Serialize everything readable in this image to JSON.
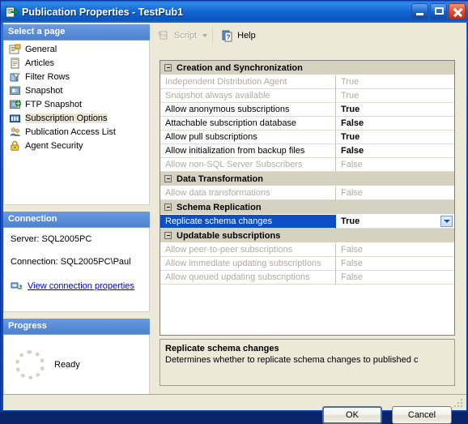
{
  "window": {
    "title": "Publication Properties - TestPub1",
    "icon": "publication-icon",
    "buttons": {
      "minimize": "Minimize",
      "maximize": "Maximize",
      "close": "Close"
    }
  },
  "sidebar": {
    "select_page_header": "Select a page",
    "items": [
      {
        "label": "General",
        "icon": "general-page-icon",
        "selected": false
      },
      {
        "label": "Articles",
        "icon": "articles-page-icon",
        "selected": false
      },
      {
        "label": "Filter Rows",
        "icon": "filter-rows-page-icon",
        "selected": false
      },
      {
        "label": "Snapshot",
        "icon": "snapshot-page-icon",
        "selected": false
      },
      {
        "label": "FTP Snapshot",
        "icon": "ftp-snapshot-page-icon",
        "selected": false
      },
      {
        "label": "Subscription Options",
        "icon": "subscription-options-page-icon",
        "selected": true
      },
      {
        "label": "Publication Access List",
        "icon": "publication-access-list-page-icon",
        "selected": false
      },
      {
        "label": "Agent Security",
        "icon": "agent-security-page-icon",
        "selected": false
      }
    ],
    "connection": {
      "header": "Connection",
      "server": "Server: SQL2005PC",
      "connection": "Connection: SQL2005PC\\Paul",
      "link": "View connection properties",
      "link_icon": "connection-properties-icon"
    },
    "progress": {
      "header": "Progress",
      "status": "Ready",
      "icon": "progress-spinner-icon"
    }
  },
  "toolbar": {
    "script_label": "Script",
    "script_icon": "script-icon",
    "script_enabled": false,
    "help_label": "Help",
    "help_icon": "help-icon"
  },
  "grid": {
    "sections": [
      {
        "title": "Creation and Synchronization",
        "rows": [
          {
            "name": "Independent Distribution Agent",
            "value": "True",
            "enabled": false,
            "selected": false
          },
          {
            "name": "Snapshot always available",
            "value": "True",
            "enabled": false,
            "selected": false
          },
          {
            "name": "Allow anonymous subscriptions",
            "value": "True",
            "enabled": true,
            "selected": false
          },
          {
            "name": "Attachable subscription database",
            "value": "False",
            "enabled": true,
            "selected": false
          },
          {
            "name": "Allow pull subscriptions",
            "value": "True",
            "enabled": true,
            "selected": false
          },
          {
            "name": "Allow initialization from backup files",
            "value": "False",
            "enabled": true,
            "selected": false
          },
          {
            "name": "Allow non-SQL Server Subscribers",
            "value": "False",
            "enabled": false,
            "selected": false
          }
        ]
      },
      {
        "title": "Data Transformation",
        "rows": [
          {
            "name": "Allow data transformations",
            "value": "False",
            "enabled": false,
            "selected": false
          }
        ]
      },
      {
        "title": "Schema Replication",
        "rows": [
          {
            "name": "Replicate schema changes",
            "value": "True",
            "enabled": true,
            "selected": true
          }
        ]
      },
      {
        "title": "Updatable subscriptions",
        "rows": [
          {
            "name": "Allow peer-to-peer subscriptions",
            "value": "False",
            "enabled": false,
            "selected": false
          },
          {
            "name": "Allow immediate updating subscriptions",
            "value": "False",
            "enabled": false,
            "selected": false
          },
          {
            "name": "Allow queued updating subscriptions",
            "value": "False",
            "enabled": false,
            "selected": false
          }
        ]
      }
    ]
  },
  "description": {
    "title": "Replicate schema changes",
    "text": "Determines whether to replicate schema changes to published c"
  },
  "footer": {
    "ok_label": "OK",
    "cancel_label": "Cancel"
  },
  "colors": {
    "title_blue": "#1267d2",
    "selection_blue": "#0a4fc4",
    "panel_beige": "#ece9d8",
    "group_header_blue": "#5b8ed8",
    "link_blue": "#0000cc",
    "disabled_gray": "#b0aca0"
  }
}
